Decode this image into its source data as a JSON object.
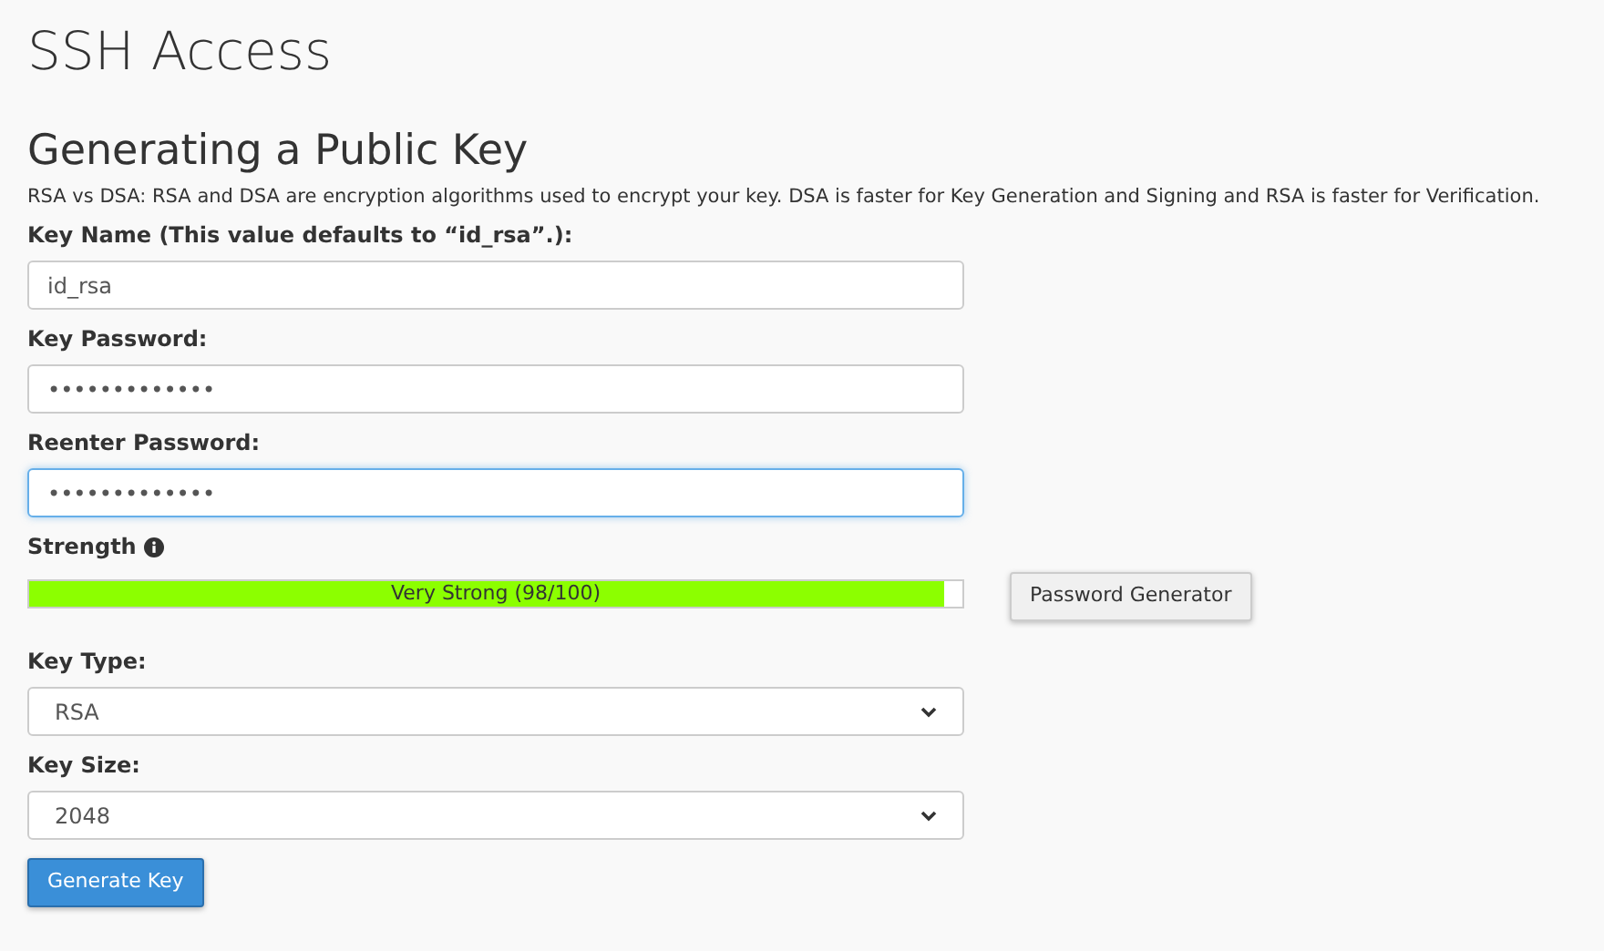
{
  "page_title": "SSH Access",
  "section_title": "Generating a Public Key",
  "description": "RSA vs DSA: RSA and DSA are encryption algorithms used to encrypt your key. DSA is faster for Key Generation and Signing and RSA is faster for Verification.",
  "fields": [
    {
      "kind": "text",
      "label": "Key Name (This value defaults to “id_rsa”.):",
      "value": "id_rsa",
      "focused": false
    },
    {
      "kind": "text",
      "label": "Key Password:",
      "value": "•••••••••••••",
      "focused": false
    },
    {
      "kind": "text",
      "label": "Reenter Password:",
      "value": "•••••••••••••",
      "focused": true
    },
    {
      "kind": "strength",
      "label": "Strength",
      "level": 0.98,
      "reading": "Very Strong (98/100)",
      "button": "Password Generator"
    },
    {
      "kind": "select",
      "label": "Key Type:",
      "value": "RSA",
      "focused": false
    },
    {
      "kind": "select",
      "label": "Key Size:",
      "value": "2048",
      "focused": false
    }
  ],
  "submit_button": "Generate Key"
}
